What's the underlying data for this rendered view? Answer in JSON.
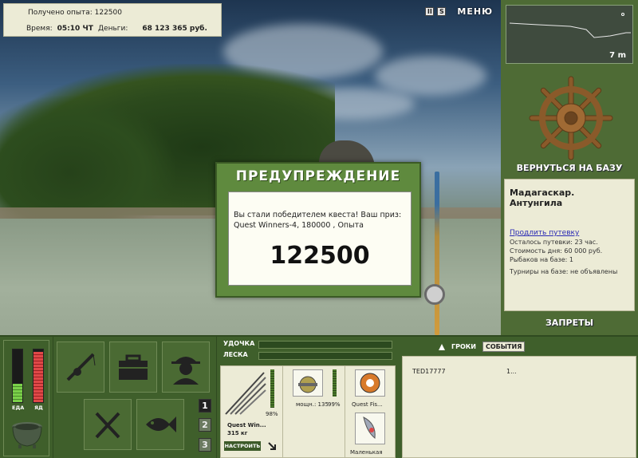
{
  "info": {
    "exp_label": "Получено опыта:",
    "exp_value": "122500",
    "time_label": "Время:",
    "time_value": "05:10 ЧТ",
    "money_label": "Деньги:",
    "money_value": "68 123 365 руб."
  },
  "top_buttons": {
    "pause": "II",
    "sound": "S",
    "menu": "МЕНЮ"
  },
  "depth": {
    "value": "7 m"
  },
  "right": {
    "return_label": "ВЕРНУТЬСЯ НА БАЗУ",
    "location_title": "Мадагаскар. Антунгила",
    "extend_link": "Продлить путевку",
    "remaining": "Осталось путевки: 23 час.",
    "day_cost": "Стоимость дня: 60 000 руб.",
    "fishers": "Рыбаков на базе: 1",
    "tournaments": "Турниры на базе: не объявлены",
    "bans_label": "ЗАПРЕТЫ"
  },
  "dialog": {
    "title": "ПРЕДУПРЕЖДЕНИЕ",
    "message": "Вы стали победителем квеста! Ваш приз: Quest Winners-4, 180000 , Опыта",
    "value": "122500"
  },
  "meters": {
    "food_label": "ЕДА",
    "poison_label": "ЯД",
    "food_level": 0.35,
    "poison_level": 0.95
  },
  "pages": [
    "1",
    "2",
    "3"
  ],
  "gear": {
    "rod_label": "УДОЧКА",
    "line_label": "ЛЕСКА",
    "rod_name": "Quest Win...",
    "rod_weight": "315 кг",
    "rod_pct": "98%",
    "reel_power": "мощн.: 135",
    "reel_pct": "99%",
    "line_name": "Quest Fis...",
    "lure_name": "Маленькая",
    "setup_label": "НАСТРОИТЬ"
  },
  "players": {
    "tab_players": "ГРОКИ",
    "tab_events": "СОБЫТИЯ",
    "rows": [
      {
        "name": "TED17777",
        "value": "1..."
      }
    ]
  },
  "colors": {
    "panel_bg": "#ecebd6",
    "green_dark": "#3f5f2b",
    "dialog_green": "#5f8a3e"
  }
}
